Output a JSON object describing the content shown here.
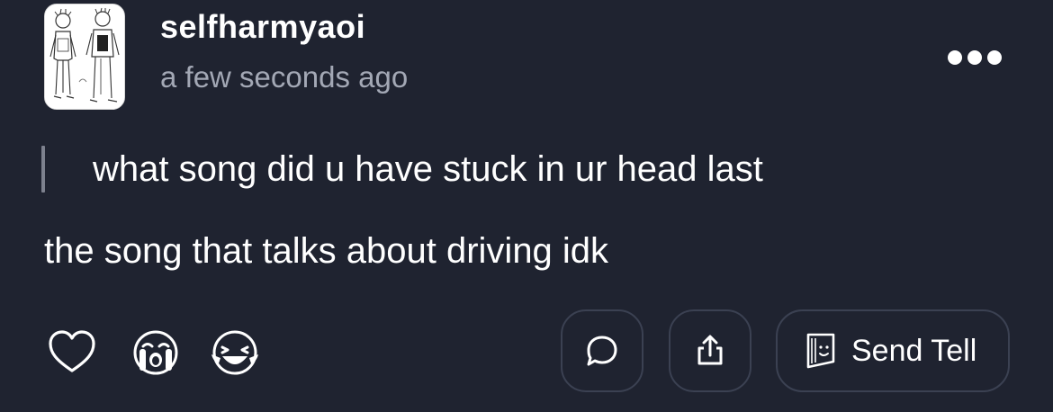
{
  "post": {
    "username": "selfharmyaoi",
    "timestamp": "a few seconds ago",
    "question": "what song did u have stuck in ur head last",
    "answer": "the song that talks about driving idk"
  },
  "actions": {
    "send_tell_label": "Send Tell"
  },
  "icons": {
    "more": "more-dots-icon",
    "heart": "heart-icon",
    "cry": "crying-face-icon",
    "laugh": "laughing-face-icon",
    "comment": "comment-bubble-icon",
    "share": "share-icon",
    "tell": "tell-note-icon"
  },
  "colors": {
    "background": "#1f2330",
    "text": "#ffffff",
    "muted": "#a3a8b5",
    "button_border": "#3b4152",
    "quote_bar": "#7d818e"
  }
}
